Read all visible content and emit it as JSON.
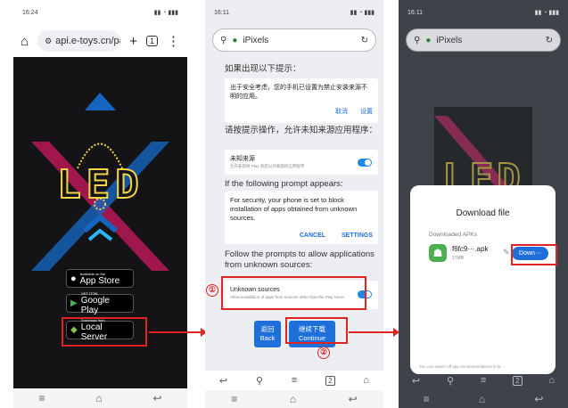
{
  "colors": {
    "red": "#e02424",
    "blue": "#1e6fd9",
    "toggle": "#1e88e5",
    "led_yellow": "#f5d547"
  },
  "phone1": {
    "time": "16:24",
    "url": "api.e-toys.cn/pa",
    "tab_count": "1",
    "buttons": [
      {
        "small": "Available on the",
        "big": "App Store",
        "icon": "apple-icon"
      },
      {
        "small": "GET ITON",
        "big": "Google Play",
        "icon": "play-icon"
      },
      {
        "small": "Download from",
        "big": "Local Server",
        "icon": "android-icon"
      }
    ],
    "hero_text": "LED"
  },
  "phone2": {
    "time": "16:11",
    "search": "iPixels",
    "cn_prompt_title": "如果出现以下提示：",
    "cn_card_text": "出于安全考虑，您的手机已设置为禁止安装来源不明的应用。",
    "cn_cancel": "取消",
    "cn_settings": "设置",
    "cn_follow": "请按提示操作，允许未知来源应用程序：",
    "cn_unknown": "未知来源",
    "cn_unknown_sub": "允许安装除 Play 商店以外来源的应用程序",
    "en_prompt_title": "If the following prompt appears:",
    "en_card_text": "For security, your phone is set to block installation of apps obtained from unknown sources.",
    "en_cancel": "CANCEL",
    "en_settings": "SETTINGS",
    "en_follow": "Follow the prompts to allow applications from unknown sources:",
    "en_unknown": "Unknown sources",
    "en_unknown_sub": "Allow installation of apps from sources other than the Play Store.",
    "back_cn": "返回",
    "back_en": "Back",
    "continue_cn": "继续下载",
    "continue_en": "Continue",
    "step1": "①",
    "step2": "②",
    "tab_count": "2"
  },
  "phone3": {
    "time": "16:11",
    "search": "iPixels",
    "dialog_title": "Download file",
    "section": "Downloaded APKs",
    "file_name": "f6fc9···.apk",
    "file_size": "17MB",
    "download_btn": "Down···",
    "footer": "You can switch off app recommendations in br···",
    "tab_count": "2"
  }
}
